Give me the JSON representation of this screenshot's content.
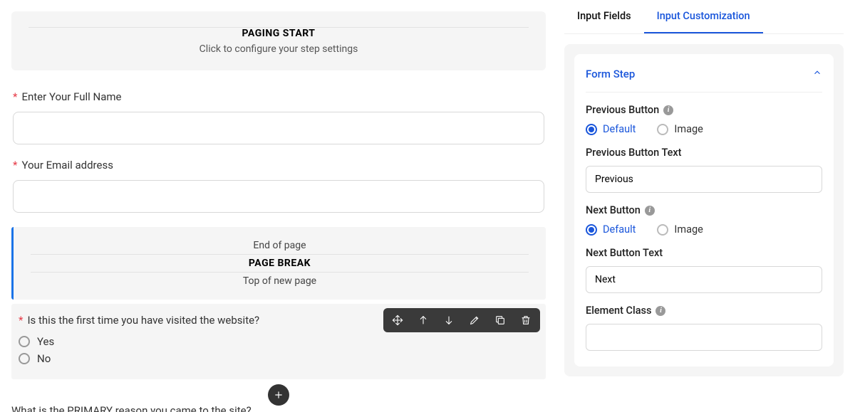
{
  "left": {
    "paging_start_title": "PAGING START",
    "paging_start_subtitle": "Click to configure your step settings",
    "field_name_label": "Enter Your Full Name",
    "field_email_label": "Your Email address",
    "pb_end": "End of page",
    "pb_title": "PAGE BREAK",
    "pb_top": "Top of new page",
    "field_visit_label": "Is this the first time you have visited the website?",
    "visit_opt1": "Yes",
    "visit_opt2": "No",
    "q_primary": "What is the PRIMARY reason you came to the site?"
  },
  "tabs": {
    "input_fields": "Input Fields",
    "input_customization": "Input Customization"
  },
  "side": {
    "card_title": "Form Step",
    "prev_btn_label": "Previous Button",
    "next_btn_label": "Next Button",
    "opt_default": "Default",
    "opt_image": "Image",
    "prev_text_label": "Previous Button Text",
    "prev_text_value": "Previous",
    "next_text_label": "Next Button Text",
    "next_text_value": "Next",
    "elem_class_label": "Element Class"
  }
}
